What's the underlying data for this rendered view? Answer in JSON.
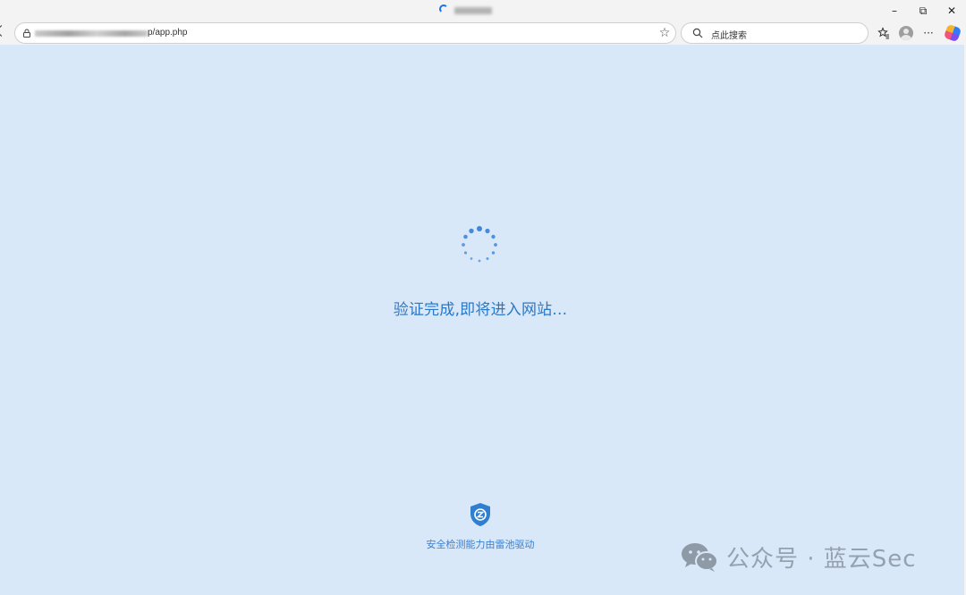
{
  "browser": {
    "tab": {
      "title_blurred": true,
      "loading": true
    },
    "window_controls": {
      "minimize": "–",
      "restore": "⧉",
      "close": "✕"
    },
    "address_bar": {
      "url_visible_suffix": "p/app.php"
    },
    "search_box": {
      "placeholder": "点此搜索"
    },
    "toolbar_icons": [
      "favorites-icon",
      "profile-avatar",
      "more-icon",
      "copilot-icon"
    ],
    "more_label": "···"
  },
  "page": {
    "status_text": "验证完成,即将进入网站...",
    "footer_text": "安全检测能力由雷池驱动",
    "colors": {
      "background": "#d8e8f9",
      "accent": "#2a78c8"
    }
  },
  "watermark": {
    "text": "公众号 · 蓝云Sec"
  }
}
